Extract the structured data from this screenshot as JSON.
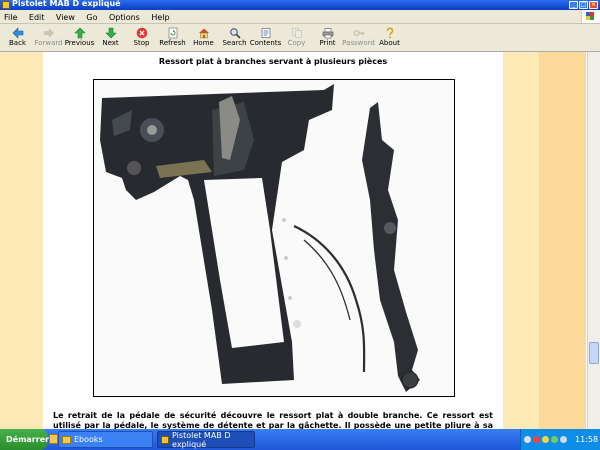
{
  "window": {
    "title": "Pistolet MAB D expliqué"
  },
  "menu": [
    "File",
    "Edit",
    "View",
    "Go",
    "Options",
    "Help"
  ],
  "toolbar": [
    {
      "label": "Back",
      "icon": "back-arrow-icon",
      "enabled": true
    },
    {
      "label": "Forward",
      "icon": "forward-arrow-icon",
      "enabled": false
    },
    {
      "label": "Previous",
      "icon": "up-arrow-icon",
      "enabled": true
    },
    {
      "label": "Next",
      "icon": "down-arrow-icon",
      "enabled": true
    },
    {
      "label": "Stop",
      "icon": "stop-icon",
      "enabled": true
    },
    {
      "label": "Refresh",
      "icon": "refresh-icon",
      "enabled": true
    },
    {
      "label": "Home",
      "icon": "home-icon",
      "enabled": true
    },
    {
      "label": "Search",
      "icon": "search-icon",
      "enabled": true
    },
    {
      "label": "Contents",
      "icon": "contents-icon",
      "enabled": true
    },
    {
      "label": "Copy",
      "icon": "copy-icon",
      "enabled": false
    },
    {
      "label": "Print",
      "icon": "print-icon",
      "enabled": true
    },
    {
      "label": "Password",
      "icon": "key-icon",
      "enabled": false
    },
    {
      "label": "About",
      "icon": "about-icon",
      "enabled": true
    }
  ],
  "page": {
    "title": "Ressort plat à branches servant à plusieurs pièces",
    "body": "Le retrait de la pédale de sécurité découvre le ressort plat à double branche. Ce ressort est utilisé par la pédale, le système de détente et par la gâchette. Il possède une petite pliure à sa base qui entre dans une fine découpe de la"
  },
  "taskbar": {
    "start_label": "Démarrer",
    "tasks": [
      {
        "label": "Ebooks",
        "active": false
      },
      {
        "label": "Pistolet MAB D expliqué",
        "active": true
      }
    ],
    "clock": "11:58"
  },
  "colors": {
    "margin": "#fde9b5",
    "margin_dark": "#fbd99a",
    "titlebar": "#0a3fbf",
    "taskbar": "#245edb"
  }
}
